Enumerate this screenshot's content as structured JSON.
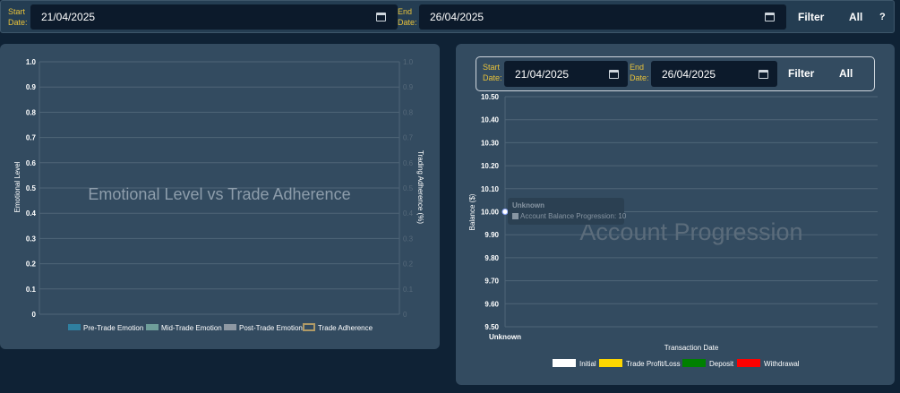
{
  "top_filter": {
    "start_label_line1": "Start",
    "start_label_line2": "Date:",
    "start_value": "21/04/2025",
    "end_label_line1": "End",
    "end_label_line2": "Date:",
    "end_value": "26/04/2025",
    "filter_label": "Filter",
    "all_label": "All",
    "help_label": "?"
  },
  "right_filter": {
    "start_label_line1": "Start",
    "start_label_line2": "Date:",
    "start_value": "21/04/2025",
    "end_label_line1": "End",
    "end_label_line2": "Date:",
    "end_value": "26/04/2025",
    "filter_label": "Filter",
    "all_label": "All"
  },
  "colors": {
    "accent_label": "#e8c23a",
    "panel_bg": "#334b60",
    "page_bg": "#0f2235"
  },
  "emotion_chart": {
    "watermark": "Emotional Level vs Trade Adherence",
    "chart_data": {
      "type": "bar",
      "title": "Emotional Level vs Trade Adherence",
      "ylabel": "Emotional Level",
      "y2label": "Trading Adherence (%)",
      "ylim": [
        0,
        1
      ],
      "y_ticks": [
        "1.0",
        "0.9",
        "0.8",
        "0.7",
        "0.6",
        "0.5",
        "0.4",
        "0.3",
        "0.2",
        "0.1",
        "0"
      ],
      "y2_ticks": [
        "1.0",
        "0.9",
        "0.8",
        "0.7",
        "0.6",
        "0.5",
        "0.4",
        "0.3",
        "0.2",
        "0.1",
        "0"
      ],
      "categories": [],
      "grid": true,
      "legend_position": "bottom",
      "series": [
        {
          "name": "Pre-Trade Emotion",
          "color": "#2f7fa0",
          "values": []
        },
        {
          "name": "Mid-Trade Emotion",
          "color": "#6f9e9a",
          "values": []
        },
        {
          "name": "Post-Trade Emotion",
          "color": "#8e98a3",
          "values": []
        },
        {
          "name": "Trade Adherence",
          "color": "#b09a66",
          "values": []
        }
      ]
    }
  },
  "balance_chart": {
    "watermark": "Account Progression",
    "tooltip": {
      "title": "Unknown",
      "line": "Account Balance Progression: 10"
    },
    "chart_data": {
      "type": "line",
      "title": "Account Progression",
      "xlabel": "Transaction Date",
      "ylabel": "Balance ($)",
      "ylim": [
        9.5,
        10.5
      ],
      "y_ticks": [
        "10.50",
        "10.40",
        "10.30",
        "10.20",
        "10.10",
        "10.00",
        "9.90",
        "9.80",
        "9.70",
        "9.60",
        "9.50"
      ],
      "categories": [
        "Unknown"
      ],
      "grid": true,
      "legend_position": "bottom",
      "series": [
        {
          "name": "Account Balance Progression",
          "color": "#ffffff",
          "values": [
            10
          ]
        }
      ],
      "legend": [
        {
          "name": "Initial",
          "color": "#ffffff"
        },
        {
          "name": "Trade Profit/Loss",
          "color": "#ffd700"
        },
        {
          "name": "Deposit",
          "color": "#008000"
        },
        {
          "name": "Withdrawal",
          "color": "#ff0000"
        }
      ]
    }
  }
}
